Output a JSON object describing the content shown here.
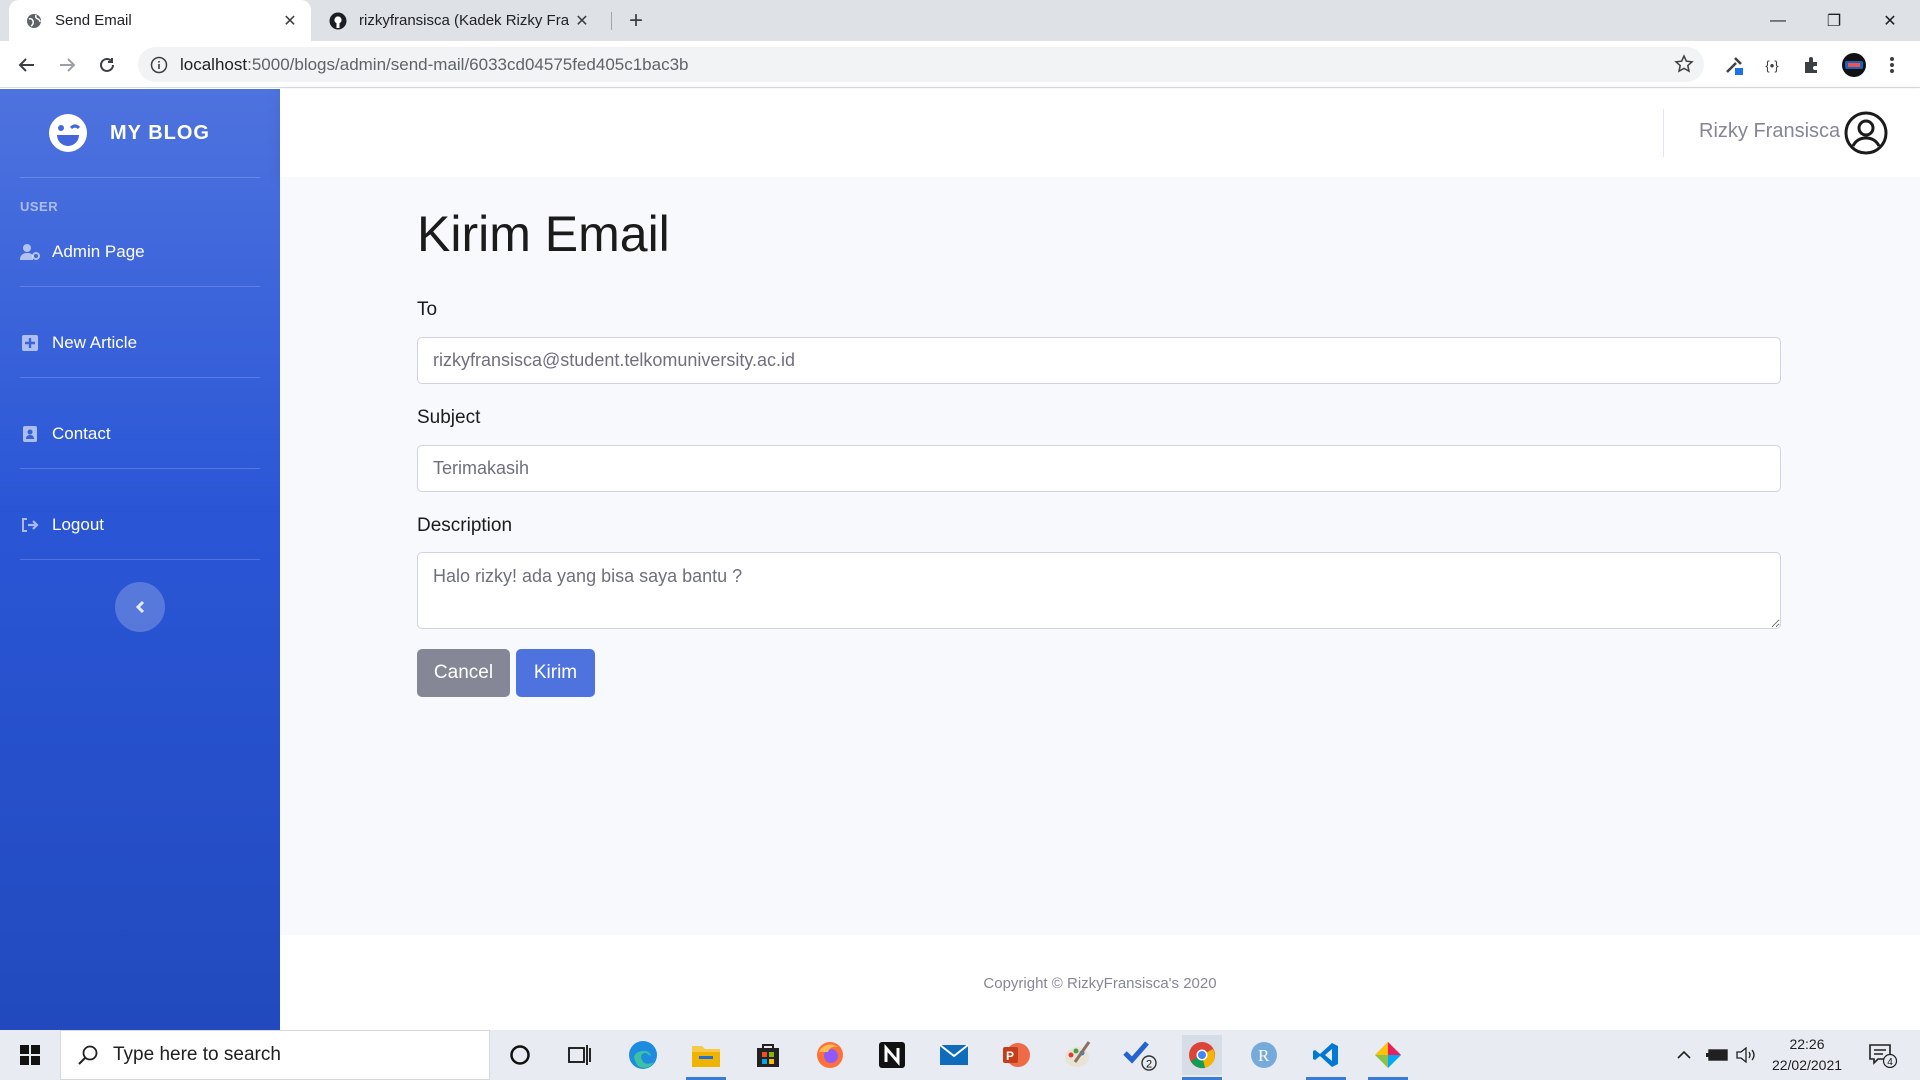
{
  "browser": {
    "tabs": [
      {
        "title": "Send Email",
        "active": true
      },
      {
        "title": "rizkyfransisca (Kadek Rizky Fransisca)",
        "active": false
      }
    ],
    "new_tab": "+",
    "window_controls": {
      "minimize": "—",
      "maximize": "❐",
      "close": "✕"
    },
    "url_host": "localhost",
    "url_rest": ":5000/blogs/admin/send-mail/6033cd04575fed405c1bac3b"
  },
  "sidebar": {
    "brand": "MY BLOG",
    "heading": "USER",
    "items": [
      {
        "label": "Admin Page",
        "icon": "user-cog-icon"
      },
      {
        "label": "New Article",
        "icon": "plus-square-icon"
      },
      {
        "label": "Contact",
        "icon": "address-book-icon"
      },
      {
        "label": "Logout",
        "icon": "sign-out-icon"
      }
    ],
    "toggle": "‹"
  },
  "topbar": {
    "user_name": "Rizky Fransisca"
  },
  "form": {
    "title": "Kirim Email",
    "to_label": "To",
    "to_value": "rizkyfransisca@student.telkomuniversity.ac.id",
    "subject_label": "Subject",
    "subject_value": "Terimakasih",
    "description_label": "Description",
    "description_value": "Halo rizky! ada yang bisa saya bantu ?",
    "cancel_label": "Cancel",
    "send_label": "Kirim"
  },
  "footer": {
    "copyright": "Copyright © RizkyFransisca's 2020"
  },
  "taskbar": {
    "search_placeholder": "Type here to search",
    "time": "22:26",
    "date": "22/02/2021",
    "notification_count": "4",
    "todo_badge": "2"
  },
  "colors": {
    "primary": "#4e73df",
    "secondary": "#858796",
    "sidebar_dark": "#224abe"
  }
}
